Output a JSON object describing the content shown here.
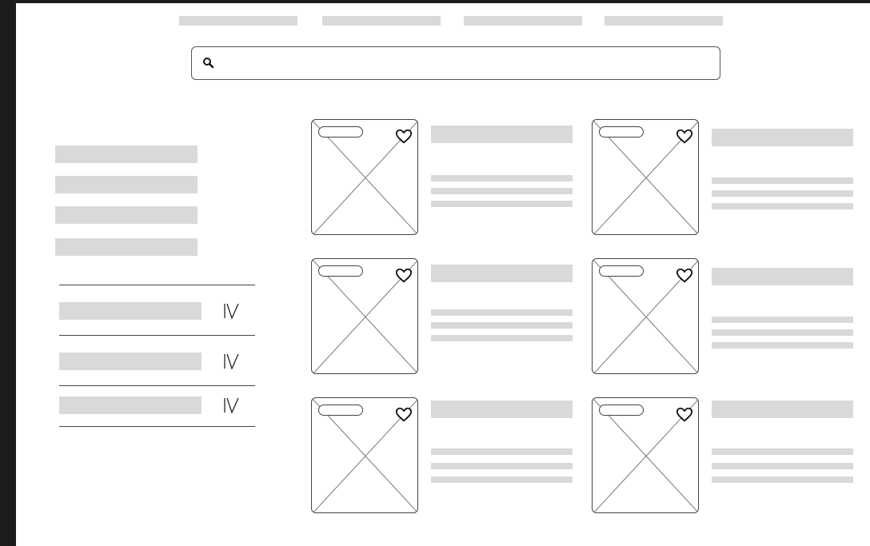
{
  "search": {
    "placeholder": "",
    "value": "",
    "icon": "search-icon"
  },
  "nav": {
    "items": [
      "",
      "",
      "",
      ""
    ]
  },
  "sidebar": {
    "categories": [
      "",
      "",
      "",
      ""
    ]
  },
  "filters": {
    "items": [
      {
        "label": "",
        "icon": "chevron-down-icon"
      },
      {
        "label": "",
        "icon": "chevron-down-icon"
      },
      {
        "label": "",
        "icon": "chevron-down-icon"
      }
    ]
  },
  "products": {
    "items": [
      {
        "badge": "",
        "title": "",
        "icon": "heart-icon"
      },
      {
        "badge": "",
        "title": "",
        "icon": "heart-icon"
      },
      {
        "badge": "",
        "title": "",
        "icon": "heart-icon"
      },
      {
        "badge": "",
        "title": "",
        "icon": "heart-icon"
      },
      {
        "badge": "",
        "title": "",
        "icon": "heart-icon"
      },
      {
        "badge": "",
        "title": "",
        "icon": "heart-icon"
      }
    ]
  },
  "colors": {
    "placeholder_bar": "#d9d9d9",
    "outline": "#444444",
    "canvas": "#ffffff",
    "background": "#1c1c1c"
  }
}
